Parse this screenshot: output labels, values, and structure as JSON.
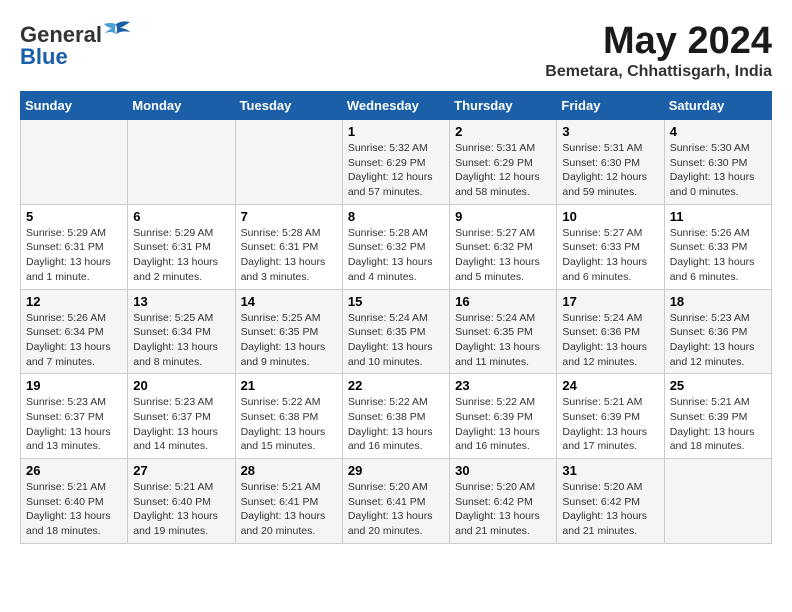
{
  "header": {
    "logo": {
      "general": "General",
      "blue": "Blue"
    },
    "title": "May 2024",
    "location": "Bemetara, Chhattisgarh, India"
  },
  "days_of_week": [
    "Sunday",
    "Monday",
    "Tuesday",
    "Wednesday",
    "Thursday",
    "Friday",
    "Saturday"
  ],
  "weeks": [
    {
      "days": [
        {
          "num": "",
          "info": ""
        },
        {
          "num": "",
          "info": ""
        },
        {
          "num": "",
          "info": ""
        },
        {
          "num": "1",
          "info": "Sunrise: 5:32 AM\nSunset: 6:29 PM\nDaylight: 12 hours\nand 57 minutes."
        },
        {
          "num": "2",
          "info": "Sunrise: 5:31 AM\nSunset: 6:29 PM\nDaylight: 12 hours\nand 58 minutes."
        },
        {
          "num": "3",
          "info": "Sunrise: 5:31 AM\nSunset: 6:30 PM\nDaylight: 12 hours\nand 59 minutes."
        },
        {
          "num": "4",
          "info": "Sunrise: 5:30 AM\nSunset: 6:30 PM\nDaylight: 13 hours\nand 0 minutes."
        }
      ]
    },
    {
      "days": [
        {
          "num": "5",
          "info": "Sunrise: 5:29 AM\nSunset: 6:31 PM\nDaylight: 13 hours\nand 1 minute."
        },
        {
          "num": "6",
          "info": "Sunrise: 5:29 AM\nSunset: 6:31 PM\nDaylight: 13 hours\nand 2 minutes."
        },
        {
          "num": "7",
          "info": "Sunrise: 5:28 AM\nSunset: 6:31 PM\nDaylight: 13 hours\nand 3 minutes."
        },
        {
          "num": "8",
          "info": "Sunrise: 5:28 AM\nSunset: 6:32 PM\nDaylight: 13 hours\nand 4 minutes."
        },
        {
          "num": "9",
          "info": "Sunrise: 5:27 AM\nSunset: 6:32 PM\nDaylight: 13 hours\nand 5 minutes."
        },
        {
          "num": "10",
          "info": "Sunrise: 5:27 AM\nSunset: 6:33 PM\nDaylight: 13 hours\nand 6 minutes."
        },
        {
          "num": "11",
          "info": "Sunrise: 5:26 AM\nSunset: 6:33 PM\nDaylight: 13 hours\nand 6 minutes."
        }
      ]
    },
    {
      "days": [
        {
          "num": "12",
          "info": "Sunrise: 5:26 AM\nSunset: 6:34 PM\nDaylight: 13 hours\nand 7 minutes."
        },
        {
          "num": "13",
          "info": "Sunrise: 5:25 AM\nSunset: 6:34 PM\nDaylight: 13 hours\nand 8 minutes."
        },
        {
          "num": "14",
          "info": "Sunrise: 5:25 AM\nSunset: 6:35 PM\nDaylight: 13 hours\nand 9 minutes."
        },
        {
          "num": "15",
          "info": "Sunrise: 5:24 AM\nSunset: 6:35 PM\nDaylight: 13 hours\nand 10 minutes."
        },
        {
          "num": "16",
          "info": "Sunrise: 5:24 AM\nSunset: 6:35 PM\nDaylight: 13 hours\nand 11 minutes."
        },
        {
          "num": "17",
          "info": "Sunrise: 5:24 AM\nSunset: 6:36 PM\nDaylight: 13 hours\nand 12 minutes."
        },
        {
          "num": "18",
          "info": "Sunrise: 5:23 AM\nSunset: 6:36 PM\nDaylight: 13 hours\nand 12 minutes."
        }
      ]
    },
    {
      "days": [
        {
          "num": "19",
          "info": "Sunrise: 5:23 AM\nSunset: 6:37 PM\nDaylight: 13 hours\nand 13 minutes."
        },
        {
          "num": "20",
          "info": "Sunrise: 5:23 AM\nSunset: 6:37 PM\nDaylight: 13 hours\nand 14 minutes."
        },
        {
          "num": "21",
          "info": "Sunrise: 5:22 AM\nSunset: 6:38 PM\nDaylight: 13 hours\nand 15 minutes."
        },
        {
          "num": "22",
          "info": "Sunrise: 5:22 AM\nSunset: 6:38 PM\nDaylight: 13 hours\nand 16 minutes."
        },
        {
          "num": "23",
          "info": "Sunrise: 5:22 AM\nSunset: 6:39 PM\nDaylight: 13 hours\nand 16 minutes."
        },
        {
          "num": "24",
          "info": "Sunrise: 5:21 AM\nSunset: 6:39 PM\nDaylight: 13 hours\nand 17 minutes."
        },
        {
          "num": "25",
          "info": "Sunrise: 5:21 AM\nSunset: 6:39 PM\nDaylight: 13 hours\nand 18 minutes."
        }
      ]
    },
    {
      "days": [
        {
          "num": "26",
          "info": "Sunrise: 5:21 AM\nSunset: 6:40 PM\nDaylight: 13 hours\nand 18 minutes."
        },
        {
          "num": "27",
          "info": "Sunrise: 5:21 AM\nSunset: 6:40 PM\nDaylight: 13 hours\nand 19 minutes."
        },
        {
          "num": "28",
          "info": "Sunrise: 5:21 AM\nSunset: 6:41 PM\nDaylight: 13 hours\nand 20 minutes."
        },
        {
          "num": "29",
          "info": "Sunrise: 5:20 AM\nSunset: 6:41 PM\nDaylight: 13 hours\nand 20 minutes."
        },
        {
          "num": "30",
          "info": "Sunrise: 5:20 AM\nSunset: 6:42 PM\nDaylight: 13 hours\nand 21 minutes."
        },
        {
          "num": "31",
          "info": "Sunrise: 5:20 AM\nSunset: 6:42 PM\nDaylight: 13 hours\nand 21 minutes."
        },
        {
          "num": "",
          "info": ""
        }
      ]
    }
  ]
}
